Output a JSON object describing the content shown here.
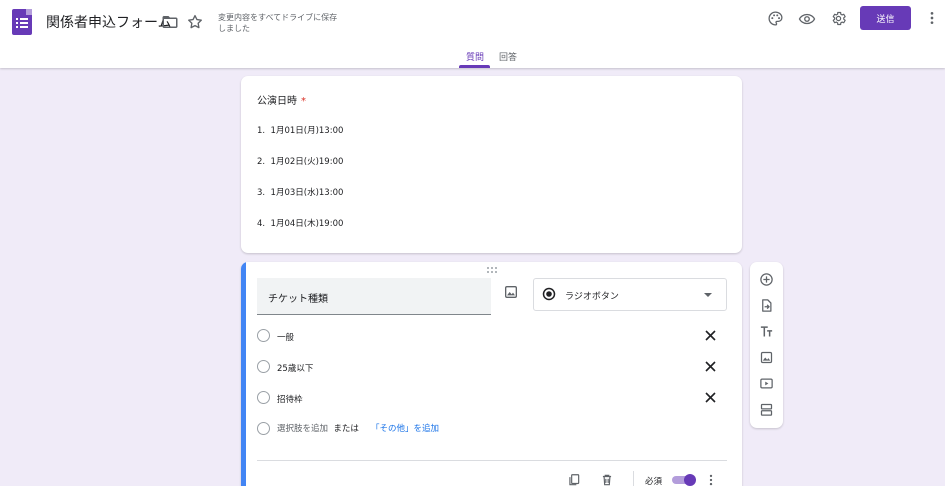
{
  "header": {
    "title": "関係者申込フォーム",
    "save_status": "変更内容をすべてドライブに保存しました",
    "send_label": "送信",
    "icons": [
      "forms-app-icon",
      "folder-icon",
      "star-icon",
      "palette-icon",
      "eye-icon",
      "gear-icon",
      "more-vert-icon"
    ]
  },
  "tabs": {
    "questions": "質問",
    "responses": "回答",
    "active": "questions"
  },
  "question1": {
    "title": "公演日時",
    "required_mark": "*",
    "items": [
      {
        "num": "1.",
        "text": "1月01日(月)13:00"
      },
      {
        "num": "2.",
        "text": "1月02日(火)19:00"
      },
      {
        "num": "3.",
        "text": "1月03日(水)13:00"
      },
      {
        "num": "4.",
        "text": "1月04日(木)19:00"
      }
    ]
  },
  "question2": {
    "title": "チケット種類",
    "type_label": "ラジオボタン",
    "options": [
      "一般",
      "25歳以下",
      "招待枠"
    ],
    "add_option_label": "選択肢を追加",
    "or_label": "または",
    "add_other_label": "「その他」を追加",
    "required_label": "必須",
    "required_on": true
  },
  "colors": {
    "accent": "#673ab7",
    "background": "#f0ebf8",
    "focus_bar": "#4285f4",
    "link": "#1a73e8",
    "required": "#d93025"
  }
}
